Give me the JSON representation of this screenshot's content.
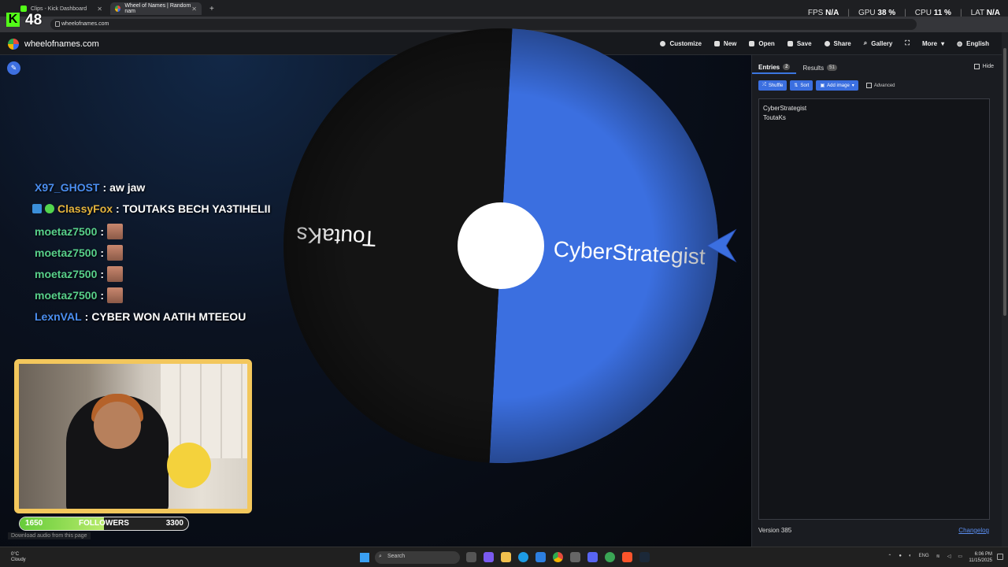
{
  "browser": {
    "tabs": [
      {
        "title": "Clips - Kick Dashboard"
      },
      {
        "title": "Wheel of Names | Random nam"
      }
    ],
    "new_tab": "+",
    "url": "wheelofnames.com"
  },
  "overlay": {
    "viewer_count": "48",
    "perf": [
      {
        "label": "FPS",
        "value": "N/A"
      },
      {
        "label": "GPU",
        "value": "38 %"
      },
      {
        "label": "CPU",
        "value": "11 %"
      },
      {
        "label": "LAT",
        "value": "N/A"
      }
    ]
  },
  "site": {
    "title": "wheelofnames.com",
    "menu": [
      "Customize",
      "New",
      "Open",
      "Save",
      "Share",
      "Gallery",
      "",
      "More",
      "English"
    ]
  },
  "wheel": {
    "segments": [
      {
        "label": "CyberStrategist",
        "color": "#3b6fe0"
      },
      {
        "label": "ToutaKs",
        "color": "#141414"
      }
    ],
    "rotation_deg": 3
  },
  "chat": [
    {
      "user": "X97_GHOST",
      "message": "aw jaw",
      "color": "blue"
    },
    {
      "user": "ClassyFox",
      "message": "TOUTAKS BECH YA3TIHELII",
      "color": "orange",
      "badges": true
    },
    {
      "user": "moetaz7500",
      "message": "",
      "color": "green",
      "emote": true
    },
    {
      "user": "moetaz7500",
      "message": "",
      "color": "green",
      "emote": true
    },
    {
      "user": "moetaz7500",
      "message": "",
      "color": "green",
      "emote": true
    },
    {
      "user": "moetaz7500",
      "message": "",
      "color": "green",
      "emote": true
    },
    {
      "user": "LexnVAL",
      "message": "CYBER WON AATIH MTEEOU",
      "color": "blue"
    }
  ],
  "followers": {
    "current": "1650",
    "label": "FOLLOWERS",
    "goal": "3300",
    "progress": 0.5
  },
  "download_hint": "Download audio from this page",
  "panel": {
    "tab_entries": "Entries",
    "entries_count": "2",
    "tab_results": "Results",
    "results_count": "51",
    "hide_label": "Hide",
    "shuffle": "Shuffle",
    "sort": "Sort",
    "add_image": "Add image",
    "advanced": "Advanced",
    "entries": [
      "CyberStrategist",
      "ToutaKs"
    ],
    "version": "Version 385",
    "changelog": "Changelog"
  },
  "taskbar": {
    "weather_temp": "0°C",
    "weather_desc": "Cloudy",
    "search_placeholder": "Search",
    "lang": "ENG",
    "time": "6:06 PM",
    "date": "11/15/2025"
  }
}
